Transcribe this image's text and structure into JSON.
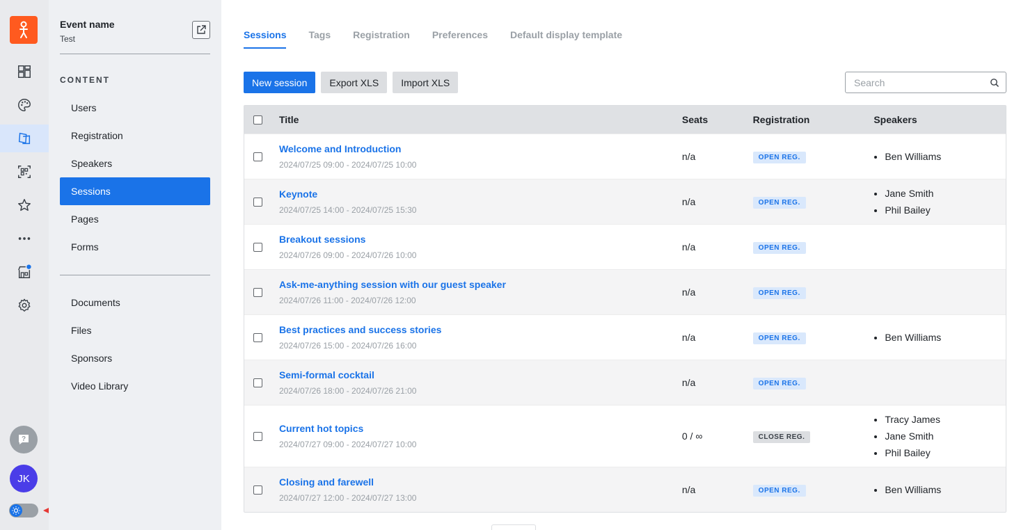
{
  "rail": {
    "items": [
      "logo-icon",
      "dashboard-icon",
      "palette-icon",
      "content-icon",
      "qr-code-icon",
      "star-icon",
      "more-icon",
      "store-icon",
      "gear-icon"
    ],
    "avatar_initials": "JK"
  },
  "nav": {
    "event_label": "Event name",
    "event_value": "Test",
    "section_label": "CONTENT",
    "items": [
      {
        "label": "Users"
      },
      {
        "label": "Registration"
      },
      {
        "label": "Speakers"
      },
      {
        "label": "Sessions",
        "active": true
      },
      {
        "label": "Pages"
      },
      {
        "label": "Forms"
      }
    ],
    "items2": [
      {
        "label": "Documents"
      },
      {
        "label": "Files"
      },
      {
        "label": "Sponsors"
      },
      {
        "label": "Video Library"
      }
    ]
  },
  "tabs": [
    "Sessions",
    "Tags",
    "Registration",
    "Preferences",
    "Default display template"
  ],
  "toolbar": {
    "new_label": "New session",
    "export_label": "Export XLS",
    "import_label": "Import XLS",
    "search_placeholder": "Search"
  },
  "table": {
    "headers": {
      "title": "Title",
      "seats": "Seats",
      "registration": "Registration",
      "speakers": "Speakers"
    },
    "rows": [
      {
        "title": "Welcome and Introduction",
        "date": "2024/07/25 09:00 - 2024/07/25 10:00",
        "seats": "n/a",
        "reg": "OPEN REG.",
        "speakers": [
          "Ben Williams"
        ]
      },
      {
        "title": "Keynote",
        "date": "2024/07/25 14:00 - 2024/07/25 15:30",
        "seats": "n/a",
        "reg": "OPEN REG.",
        "speakers": [
          "Jane Smith",
          "Phil Bailey"
        ]
      },
      {
        "title": "Breakout sessions",
        "date": "2024/07/26 09:00 - 2024/07/26 10:00",
        "seats": "n/a",
        "reg": "OPEN REG.",
        "speakers": []
      },
      {
        "title": "Ask-me-anything session with our guest speaker",
        "date": "2024/07/26 11:00 - 2024/07/26 12:00",
        "seats": "n/a",
        "reg": "OPEN REG.",
        "speakers": []
      },
      {
        "title": "Best practices and success stories",
        "date": "2024/07/26 15:00 - 2024/07/26 16:00",
        "seats": "n/a",
        "reg": "OPEN REG.",
        "speakers": [
          "Ben Williams"
        ]
      },
      {
        "title": "Semi-formal cocktail",
        "date": "2024/07/26 18:00 - 2024/07/26 21:00",
        "seats": "n/a",
        "reg": "OPEN REG.",
        "speakers": []
      },
      {
        "title": "Current hot topics",
        "date": "2024/07/27 09:00 - 2024/07/27 10:00",
        "seats": "0 / ∞",
        "reg": "CLOSE REG.",
        "speakers": [
          "Tracy James",
          "Jane Smith",
          "Phil Bailey"
        ]
      },
      {
        "title": "Closing and farewell",
        "date": "2024/07/27 12:00 - 2024/07/27 13:00",
        "seats": "n/a",
        "reg": "OPEN REG.",
        "speakers": [
          "Ben Williams"
        ]
      }
    ]
  },
  "colors": {
    "accent": "#1a73e8",
    "brand": "#ff5a1f",
    "avatar": "#4a3de8",
    "annotation_arrow": "#e53935"
  }
}
